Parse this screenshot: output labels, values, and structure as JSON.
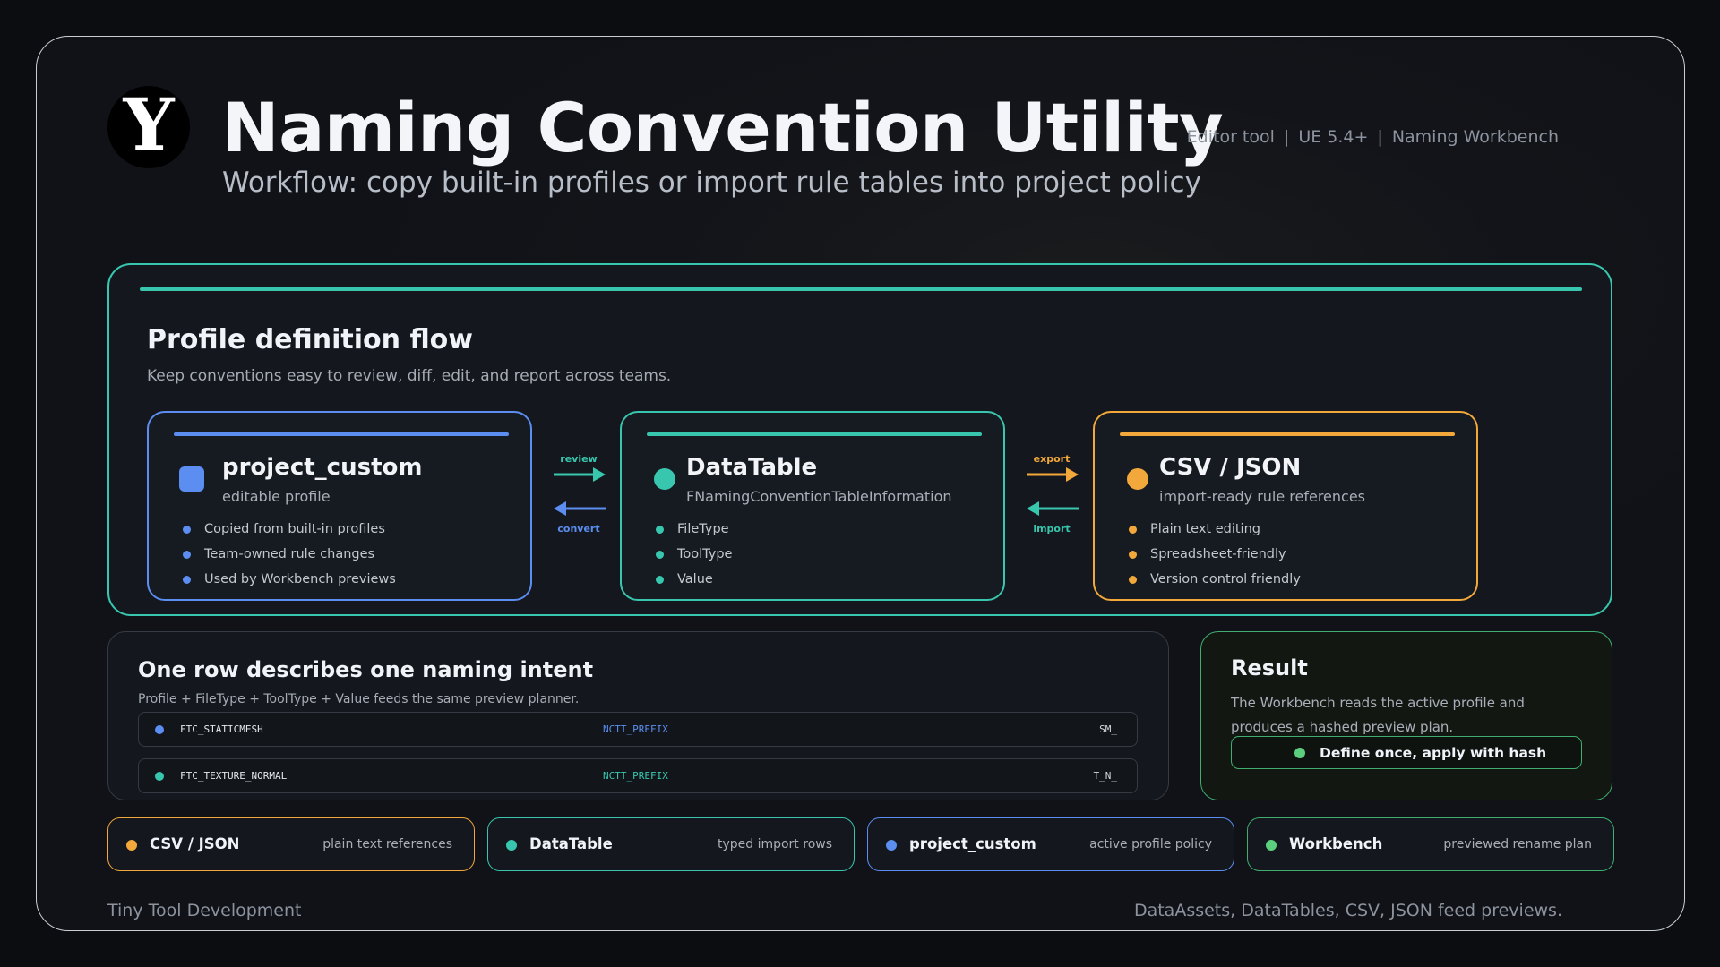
{
  "header": {
    "logo_letter": "Y",
    "title": "Naming Convention Utility",
    "subtitle": "Workflow: copy built-in profiles or import rule tables into project policy",
    "meta": [
      "Editor tool",
      "UE 5.4+",
      "Naming Workbench"
    ],
    "meta_separator": "|"
  },
  "flow": {
    "title": "Profile definition flow",
    "description": "Keep conventions easy to review, diff, edit, and report across teams.",
    "cards": [
      {
        "title": "project_custom",
        "subtitle": "editable profile",
        "color": "#5b8ef0",
        "marker_icon": "blue-square-icon",
        "items": [
          "Copied from built-in profiles",
          "Team-owned rule changes",
          "Used by Workbench previews"
        ]
      },
      {
        "title": "DataTable",
        "subtitle": "FNamingConventionTableInformation",
        "color": "#38c7ae",
        "marker_icon": "teal-dot-icon",
        "items": [
          "FileType",
          "ToolType",
          "Value"
        ]
      },
      {
        "title": "CSV / JSON",
        "subtitle": "import-ready rule references",
        "color": "#f2a83b",
        "marker_icon": "orange-dot-icon",
        "items": [
          "Plain text editing",
          "Spreadsheet-friendly",
          "Version control friendly"
        ]
      }
    ],
    "connectors": [
      {
        "top_label": "review",
        "top_color": "#38c7ae",
        "bottom_label": "convert",
        "bottom_color": "#5b8ef0"
      },
      {
        "top_label": "export",
        "top_color": "#f2a83b",
        "bottom_label": "import",
        "bottom_color": "#38c7ae"
      }
    ]
  },
  "intent": {
    "title": "One row describes one naming intent",
    "description": "Profile + FileType + ToolType + Value feeds the same preview planner.",
    "rows": [
      {
        "key": "FTC_STATICMESH",
        "type": "NCTT_PREFIX",
        "value": "SM_",
        "color": "#5b8ef0"
      },
      {
        "key": "FTC_TEXTURE_NORMAL",
        "type": "NCTT_PREFIX",
        "value": "T_N_",
        "color": "#38c7ae"
      }
    ]
  },
  "result": {
    "title": "Result",
    "description": "The Workbench reads the active profile and produces a hashed preview plan.",
    "pill": "Define once, apply with hash",
    "color": "#3fae6f"
  },
  "chips": [
    {
      "label": "CSV / JSON",
      "desc": "plain text references",
      "color": "#f2a83b"
    },
    {
      "label": "DataTable",
      "desc": "typed import rows",
      "color": "#38c7ae"
    },
    {
      "label": "project_custom",
      "desc": "active profile policy",
      "color": "#5b8ef0"
    },
    {
      "label": "Workbench",
      "desc": "previewed rename plan",
      "color": "#5ccf7f"
    }
  ],
  "footer": {
    "left": "Tiny Tool Development",
    "right": "DataAssets, DataTables, CSV, JSON feed previews."
  }
}
